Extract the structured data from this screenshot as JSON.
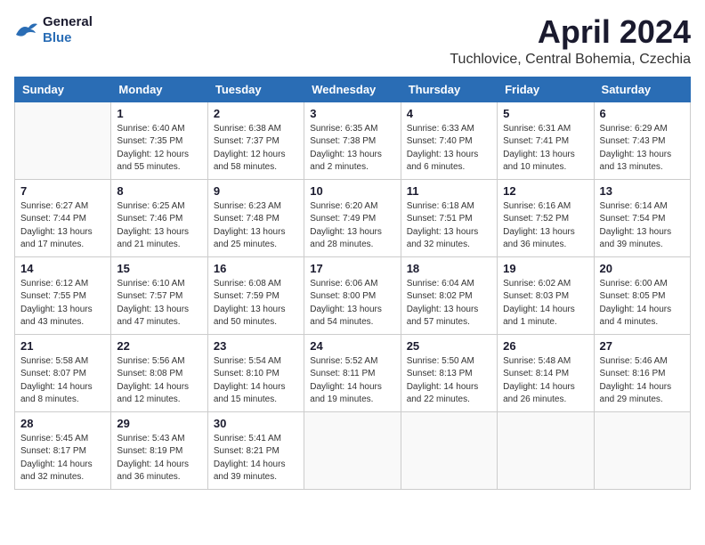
{
  "header": {
    "logo_line1": "General",
    "logo_line2": "Blue",
    "title": "April 2024",
    "subtitle": "Tuchlovice, Central Bohemia, Czechia"
  },
  "weekdays": [
    "Sunday",
    "Monday",
    "Tuesday",
    "Wednesday",
    "Thursday",
    "Friday",
    "Saturday"
  ],
  "weeks": [
    [
      {
        "day": "",
        "info": ""
      },
      {
        "day": "1",
        "info": "Sunrise: 6:40 AM\nSunset: 7:35 PM\nDaylight: 12 hours\nand 55 minutes."
      },
      {
        "day": "2",
        "info": "Sunrise: 6:38 AM\nSunset: 7:37 PM\nDaylight: 12 hours\nand 58 minutes."
      },
      {
        "day": "3",
        "info": "Sunrise: 6:35 AM\nSunset: 7:38 PM\nDaylight: 13 hours\nand 2 minutes."
      },
      {
        "day": "4",
        "info": "Sunrise: 6:33 AM\nSunset: 7:40 PM\nDaylight: 13 hours\nand 6 minutes."
      },
      {
        "day": "5",
        "info": "Sunrise: 6:31 AM\nSunset: 7:41 PM\nDaylight: 13 hours\nand 10 minutes."
      },
      {
        "day": "6",
        "info": "Sunrise: 6:29 AM\nSunset: 7:43 PM\nDaylight: 13 hours\nand 13 minutes."
      }
    ],
    [
      {
        "day": "7",
        "info": "Sunrise: 6:27 AM\nSunset: 7:44 PM\nDaylight: 13 hours\nand 17 minutes."
      },
      {
        "day": "8",
        "info": "Sunrise: 6:25 AM\nSunset: 7:46 PM\nDaylight: 13 hours\nand 21 minutes."
      },
      {
        "day": "9",
        "info": "Sunrise: 6:23 AM\nSunset: 7:48 PM\nDaylight: 13 hours\nand 25 minutes."
      },
      {
        "day": "10",
        "info": "Sunrise: 6:20 AM\nSunset: 7:49 PM\nDaylight: 13 hours\nand 28 minutes."
      },
      {
        "day": "11",
        "info": "Sunrise: 6:18 AM\nSunset: 7:51 PM\nDaylight: 13 hours\nand 32 minutes."
      },
      {
        "day": "12",
        "info": "Sunrise: 6:16 AM\nSunset: 7:52 PM\nDaylight: 13 hours\nand 36 minutes."
      },
      {
        "day": "13",
        "info": "Sunrise: 6:14 AM\nSunset: 7:54 PM\nDaylight: 13 hours\nand 39 minutes."
      }
    ],
    [
      {
        "day": "14",
        "info": "Sunrise: 6:12 AM\nSunset: 7:55 PM\nDaylight: 13 hours\nand 43 minutes."
      },
      {
        "day": "15",
        "info": "Sunrise: 6:10 AM\nSunset: 7:57 PM\nDaylight: 13 hours\nand 47 minutes."
      },
      {
        "day": "16",
        "info": "Sunrise: 6:08 AM\nSunset: 7:59 PM\nDaylight: 13 hours\nand 50 minutes."
      },
      {
        "day": "17",
        "info": "Sunrise: 6:06 AM\nSunset: 8:00 PM\nDaylight: 13 hours\nand 54 minutes."
      },
      {
        "day": "18",
        "info": "Sunrise: 6:04 AM\nSunset: 8:02 PM\nDaylight: 13 hours\nand 57 minutes."
      },
      {
        "day": "19",
        "info": "Sunrise: 6:02 AM\nSunset: 8:03 PM\nDaylight: 14 hours\nand 1 minute."
      },
      {
        "day": "20",
        "info": "Sunrise: 6:00 AM\nSunset: 8:05 PM\nDaylight: 14 hours\nand 4 minutes."
      }
    ],
    [
      {
        "day": "21",
        "info": "Sunrise: 5:58 AM\nSunset: 8:07 PM\nDaylight: 14 hours\nand 8 minutes."
      },
      {
        "day": "22",
        "info": "Sunrise: 5:56 AM\nSunset: 8:08 PM\nDaylight: 14 hours\nand 12 minutes."
      },
      {
        "day": "23",
        "info": "Sunrise: 5:54 AM\nSunset: 8:10 PM\nDaylight: 14 hours\nand 15 minutes."
      },
      {
        "day": "24",
        "info": "Sunrise: 5:52 AM\nSunset: 8:11 PM\nDaylight: 14 hours\nand 19 minutes."
      },
      {
        "day": "25",
        "info": "Sunrise: 5:50 AM\nSunset: 8:13 PM\nDaylight: 14 hours\nand 22 minutes."
      },
      {
        "day": "26",
        "info": "Sunrise: 5:48 AM\nSunset: 8:14 PM\nDaylight: 14 hours\nand 26 minutes."
      },
      {
        "day": "27",
        "info": "Sunrise: 5:46 AM\nSunset: 8:16 PM\nDaylight: 14 hours\nand 29 minutes."
      }
    ],
    [
      {
        "day": "28",
        "info": "Sunrise: 5:45 AM\nSunset: 8:17 PM\nDaylight: 14 hours\nand 32 minutes."
      },
      {
        "day": "29",
        "info": "Sunrise: 5:43 AM\nSunset: 8:19 PM\nDaylight: 14 hours\nand 36 minutes."
      },
      {
        "day": "30",
        "info": "Sunrise: 5:41 AM\nSunset: 8:21 PM\nDaylight: 14 hours\nand 39 minutes."
      },
      {
        "day": "",
        "info": ""
      },
      {
        "day": "",
        "info": ""
      },
      {
        "day": "",
        "info": ""
      },
      {
        "day": "",
        "info": ""
      }
    ]
  ]
}
